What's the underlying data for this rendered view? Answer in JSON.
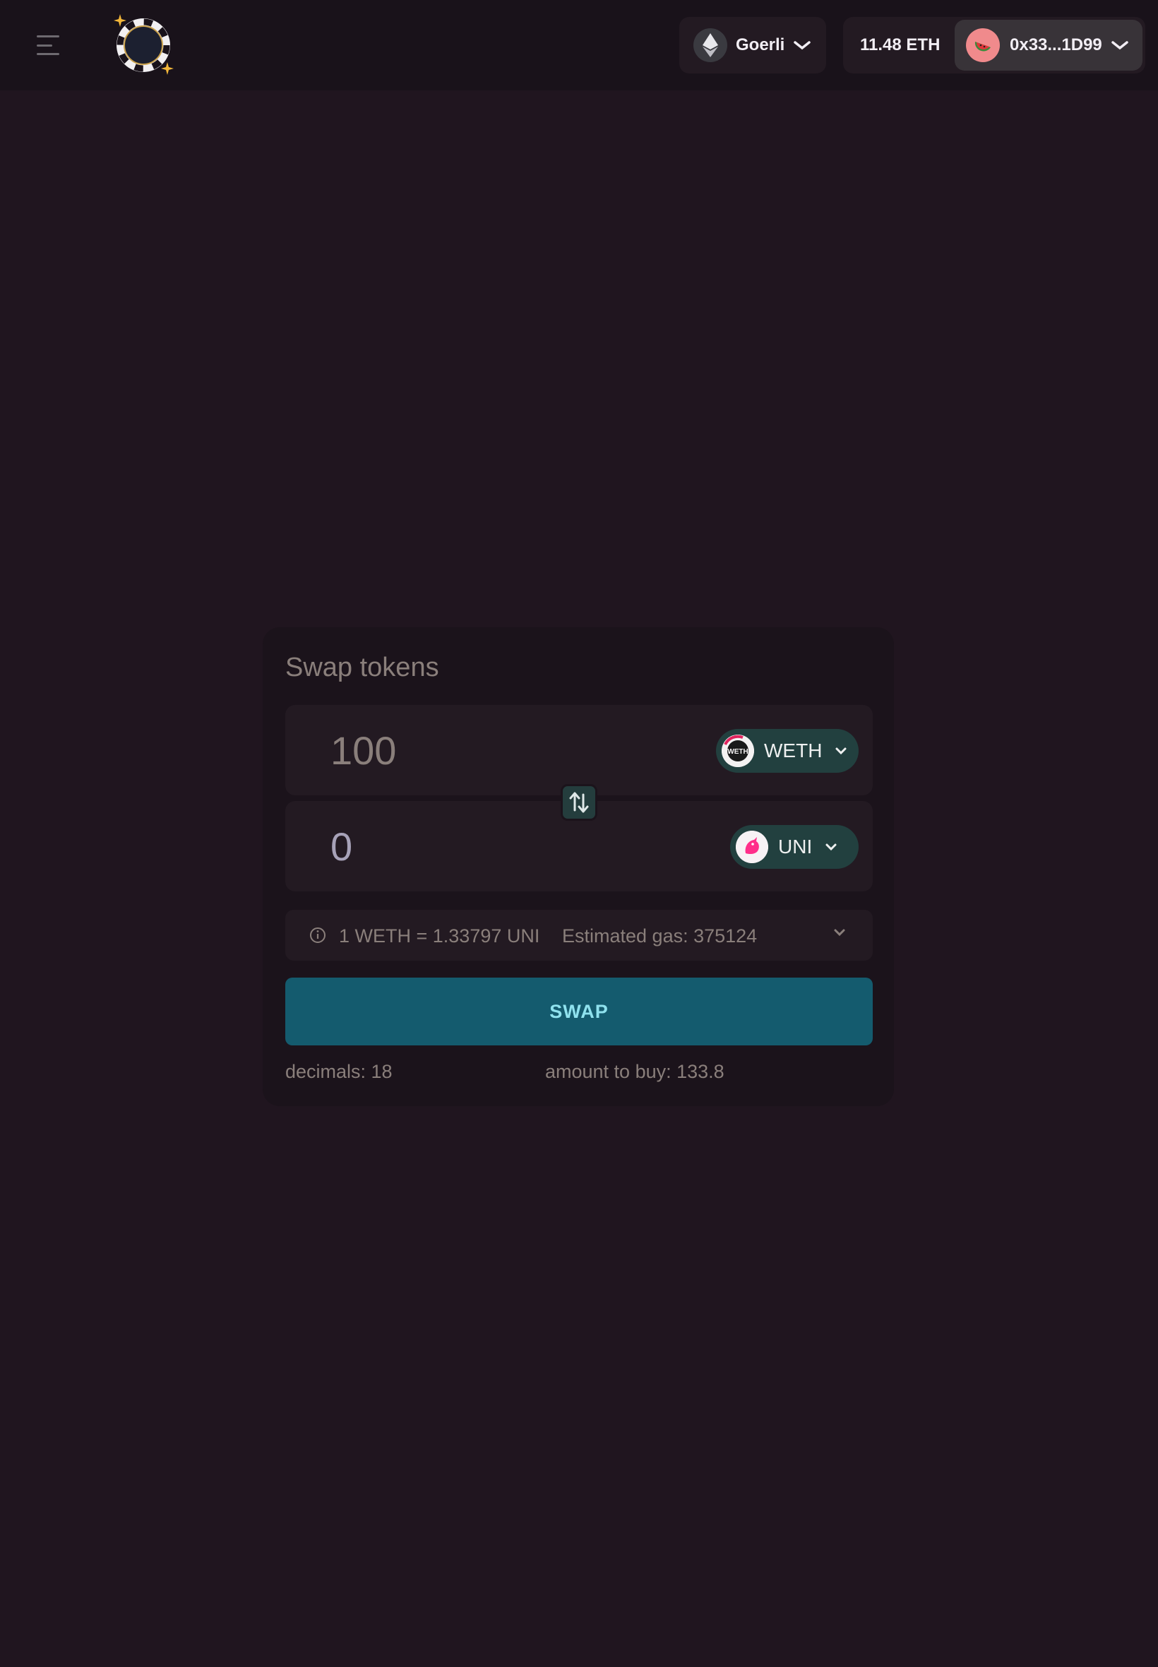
{
  "header": {
    "network": {
      "label": "Goerli",
      "icon": "ethereum-icon"
    },
    "balance": "11.48 ETH",
    "account": {
      "address": "0x33...1D99",
      "avatar": "watermelon-icon"
    }
  },
  "swap": {
    "title": "Swap tokens",
    "from": {
      "amount": "100",
      "token": "WETH",
      "icon_text": "WETH"
    },
    "to": {
      "amount": "0",
      "token": "UNI"
    },
    "rate": "1 WETH = 1.33797 UNI",
    "gas": "Estimated gas: 375124",
    "button": "SWAP",
    "decimals": "decimals: 18",
    "amount_to_buy": "amount to buy: 133.8"
  },
  "colors": {
    "background": "#20151f",
    "card": "#1b131b",
    "accent": "#145b6e",
    "token_pill": "#22403f"
  }
}
